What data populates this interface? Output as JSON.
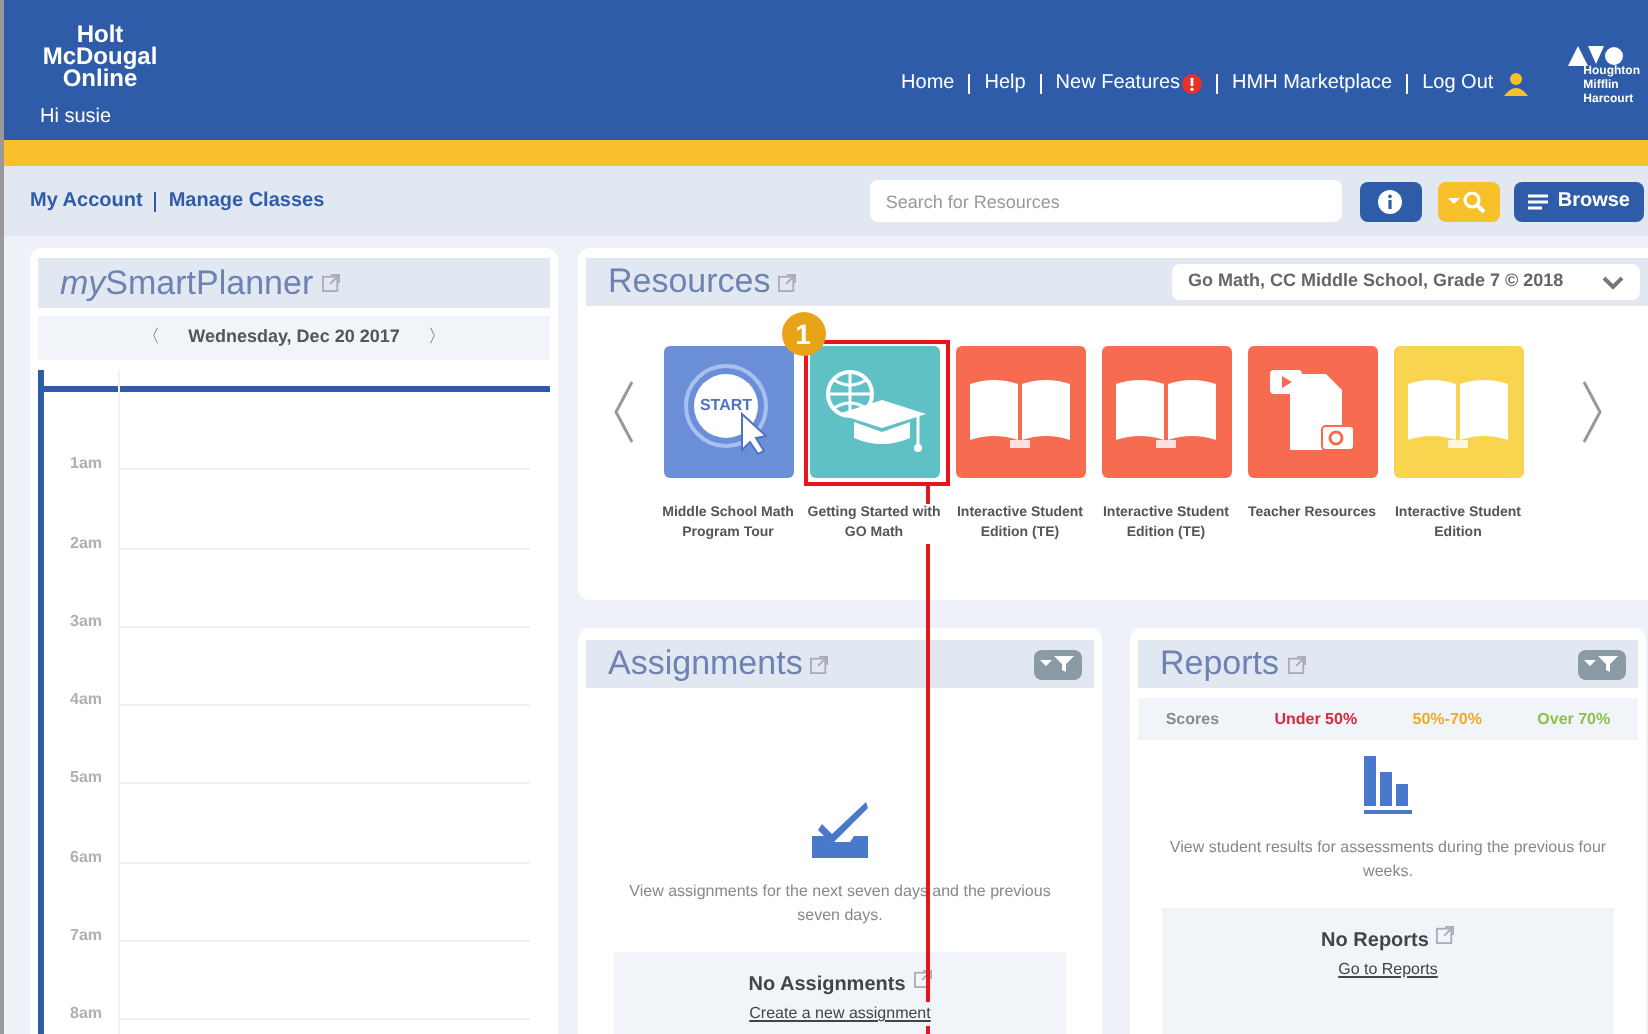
{
  "header": {
    "logo_lines": [
      "Holt",
      "McDougal",
      "Online"
    ],
    "greeting": "Hi susie",
    "nav": [
      {
        "label": "Home",
        "alert": false
      },
      {
        "label": "Help",
        "alert": false
      },
      {
        "label": "New Features",
        "alert": true
      },
      {
        "label": "HMH Marketplace",
        "alert": false
      },
      {
        "label": "Log Out",
        "alert": false
      }
    ],
    "publisher_lines": [
      "Houghton",
      "Mifflin",
      "Harcourt"
    ]
  },
  "subnav": {
    "links": [
      "My Account",
      "Manage Classes"
    ],
    "search": {
      "placeholder": "Search for Resources"
    },
    "browse": "Browse"
  },
  "planner": {
    "title_prefix": "my",
    "title": "SmartPlanner",
    "date": "Wednesday, Dec 20 2017",
    "prev": "〈",
    "next": "〉",
    "hours": [
      "1am",
      "2am",
      "3am",
      "4am",
      "5am",
      "6am",
      "7am",
      "8am"
    ]
  },
  "resources": {
    "title": "Resources",
    "program": "Go Math, CC Middle School, Grade 7 © 2018",
    "tiles": [
      {
        "label": "Middle School Math Program Tour",
        "kind": "start",
        "icon_text": "START",
        "color": "#6b8fd6",
        "highlighted": false
      },
      {
        "label": "Getting Started with GO Math",
        "kind": "globe",
        "color": "#5fc0c6",
        "highlighted": true
      },
      {
        "label": "Interactive Student Edition (TE)",
        "kind": "book",
        "color": "#f76b51",
        "highlighted": false
      },
      {
        "label": "Interactive Student Edition (TE)",
        "kind": "book",
        "color": "#f76b51",
        "highlighted": false
      },
      {
        "label": "Teacher Resources",
        "kind": "media",
        "color": "#f76b51",
        "highlighted": false
      },
      {
        "label": "Interactive Student Edition",
        "kind": "book",
        "color": "#f9d44f",
        "highlighted": false
      }
    ],
    "callout_number": "1"
  },
  "assignments": {
    "title": "Assignments",
    "description": "View assignments for the next seven days and the previous seven days.",
    "empty_title": "No Assignments",
    "link": "Create a new assignment"
  },
  "reports": {
    "title": "Reports",
    "legend": [
      {
        "label": "Scores",
        "color": "#8a8a8a"
      },
      {
        "label": "Under 50%",
        "color": "#d9283f"
      },
      {
        "label": "50%-70%",
        "color": "#f0a92c"
      },
      {
        "label": "Over 70%",
        "color": "#8fc04a"
      }
    ],
    "description": "View student results for assessments during the previous four weeks.",
    "empty_title": "No Reports",
    "link": "Go to Reports"
  }
}
